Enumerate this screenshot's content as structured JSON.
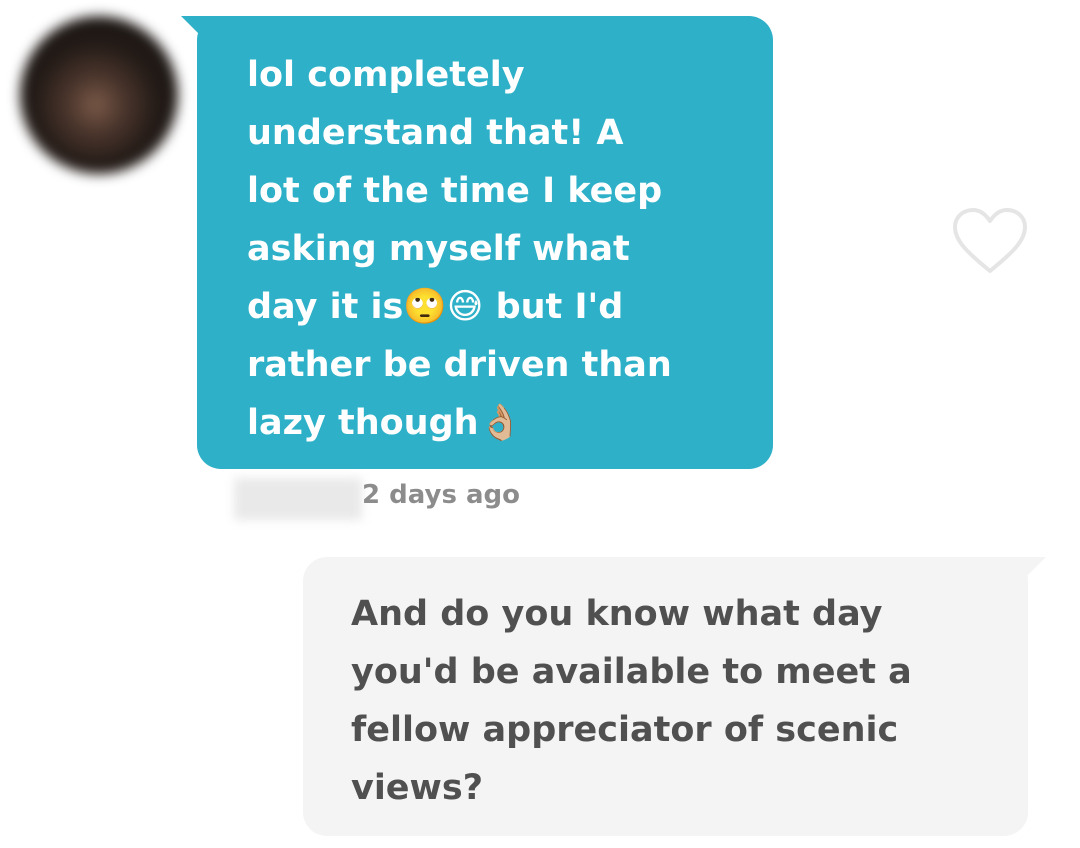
{
  "thread": {
    "received_message": {
      "text": "lol completely\nunderstand that! A\nlot of the time I keep\nasking myself what\nday it is🙄😅 but I'd\nrather be driven than\nlazy though👌🏼",
      "timestamp": "2 days ago",
      "bubble_color": "#2db0c8",
      "text_color": "#ffffff"
    },
    "sent_message": {
      "text": "And do you know what day\nyou'd be available to meet a\nfellow appreciator of scenic\nviews?",
      "bubble_color": "#f4f4f4",
      "text_color": "#505050"
    },
    "icons": {
      "like": "heart-outline-icon",
      "avatar": "blurred-profile-photo"
    }
  }
}
